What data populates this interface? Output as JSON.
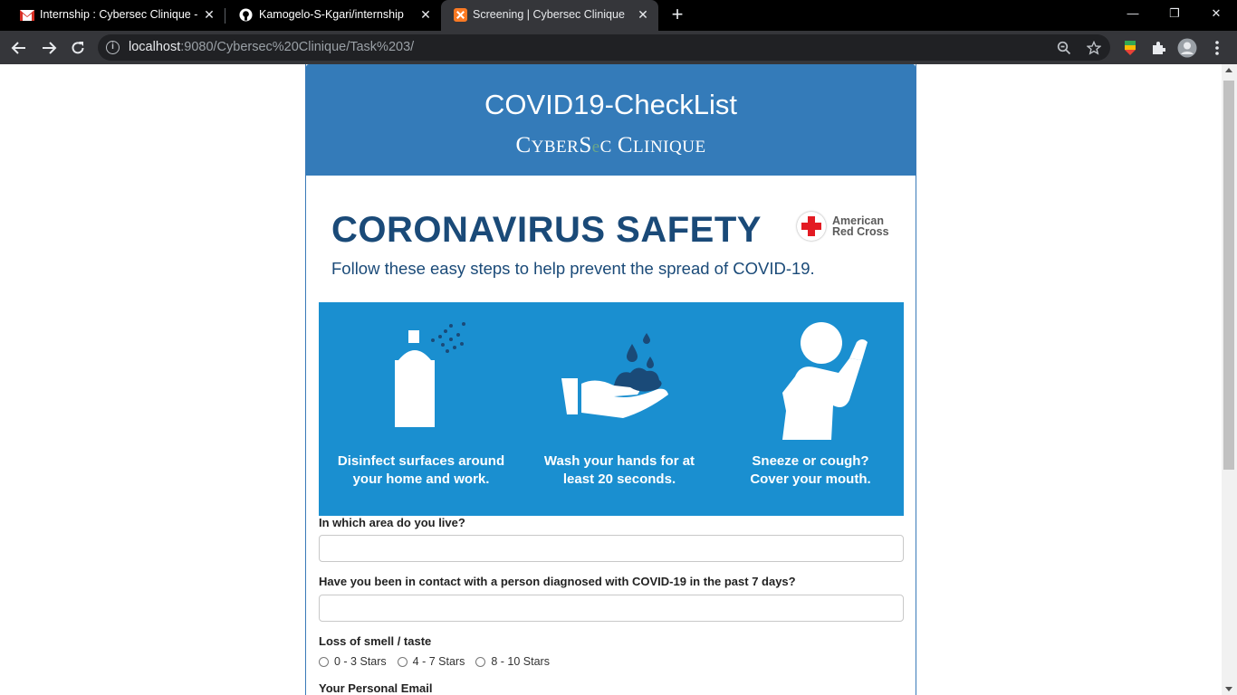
{
  "browser": {
    "tabs": [
      {
        "title": "Internship : Cybersec Clinique - k",
        "icon": "gmail-icon",
        "active": false
      },
      {
        "title": "Kamogelo-S-Kgari/internship",
        "icon": "github-icon",
        "active": false
      },
      {
        "title": "Screening | Cybersec Clinique",
        "icon": "xampp-icon",
        "active": true
      }
    ],
    "url_host": "localhost",
    "url_rest": ":9080/Cybersec%20Clinique/Task%203/",
    "new_tab_symbol": "+",
    "close_symbol": "✕",
    "minimize_symbol": "—",
    "restore_symbol": "❐",
    "window_close_symbol": "✕"
  },
  "header": {
    "title": "COVID19-CheckList",
    "brand_prefix": "C",
    "brand_small1": "YBER",
    "brand_mid": "S",
    "brand_small2": "C",
    "brand_end": "C",
    "brand_small3": "LINIQUE"
  },
  "infographic": {
    "title": "CORONAVIRUS SAFETY",
    "subtitle": "Follow these easy steps to help prevent the spread of COVID-19.",
    "org_line1": "American",
    "org_line2": "Red Cross",
    "steps": [
      {
        "line1": "Disinfect surfaces around",
        "line2": "your home and work.",
        "icon": "spray-bottle-icon"
      },
      {
        "line1": "Wash your hands for at",
        "line2": "least 20 seconds.",
        "icon": "hand-wash-icon"
      },
      {
        "line1": "Sneeze or cough?",
        "line2": "Cover your mouth.",
        "icon": "person-cough-icon"
      }
    ],
    "accent_color": "#1a8fd0",
    "title_color": "#1a4a78"
  },
  "form": {
    "q1": {
      "label": "In which area do you live?",
      "value": ""
    },
    "q2": {
      "label": "Have you been in contact with a person diagnosed with COVID-19 in the past 7 days?",
      "value": ""
    },
    "q3": {
      "label": "Loss of smell / taste",
      "options": [
        "0 - 3 Stars",
        "4 - 7 Stars",
        "8 - 10 Stars"
      ]
    },
    "q4": {
      "label": "Your Personal Email"
    }
  },
  "colors": {
    "header_bg": "#347bb9",
    "browser_bg": "#000000",
    "toolbar_bg": "#35363a"
  }
}
